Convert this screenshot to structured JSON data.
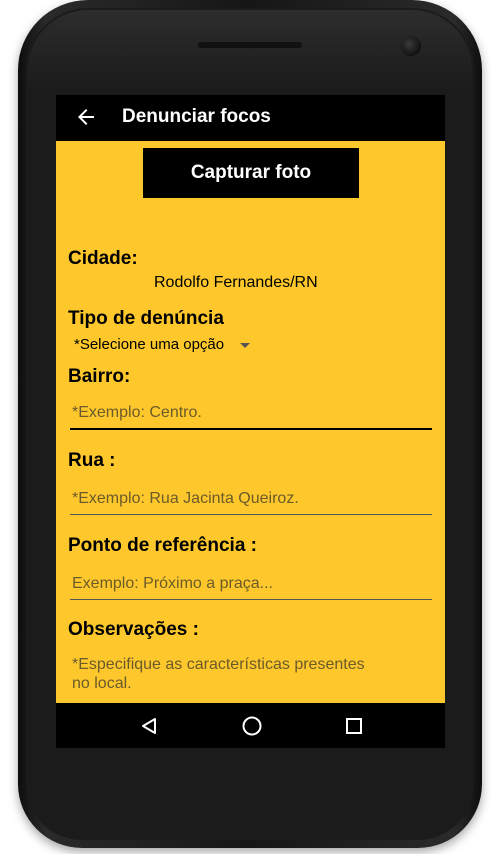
{
  "appbar": {
    "title": "Denunciar focos",
    "back_icon": "arrow-left-icon"
  },
  "form": {
    "capture_button_label": "Capturar foto",
    "city": {
      "label": "Cidade:",
      "value": "Rodolfo Fernandes/RN"
    },
    "complaint_type": {
      "label": "Tipo de denúncia",
      "selected": "*Selecione uma opção"
    },
    "neighborhood": {
      "label": "Bairro:",
      "placeholder": "*Exemplo: Centro."
    },
    "street": {
      "label": "Rua :",
      "placeholder": "*Exemplo: Rua Jacinta Queiroz."
    },
    "reference": {
      "label": "Ponto de referência :",
      "placeholder": "Exemplo: Próximo a praça..."
    },
    "observations": {
      "label": "Observações :",
      "placeholder": "*Especifique as características presentes no local."
    }
  },
  "navbar": {
    "back": "triangle-back-icon",
    "home": "circle-home-icon",
    "recents": "square-recents-icon"
  },
  "colors": {
    "background": "#fec82c",
    "bar": "#000000",
    "text": "#000000"
  }
}
